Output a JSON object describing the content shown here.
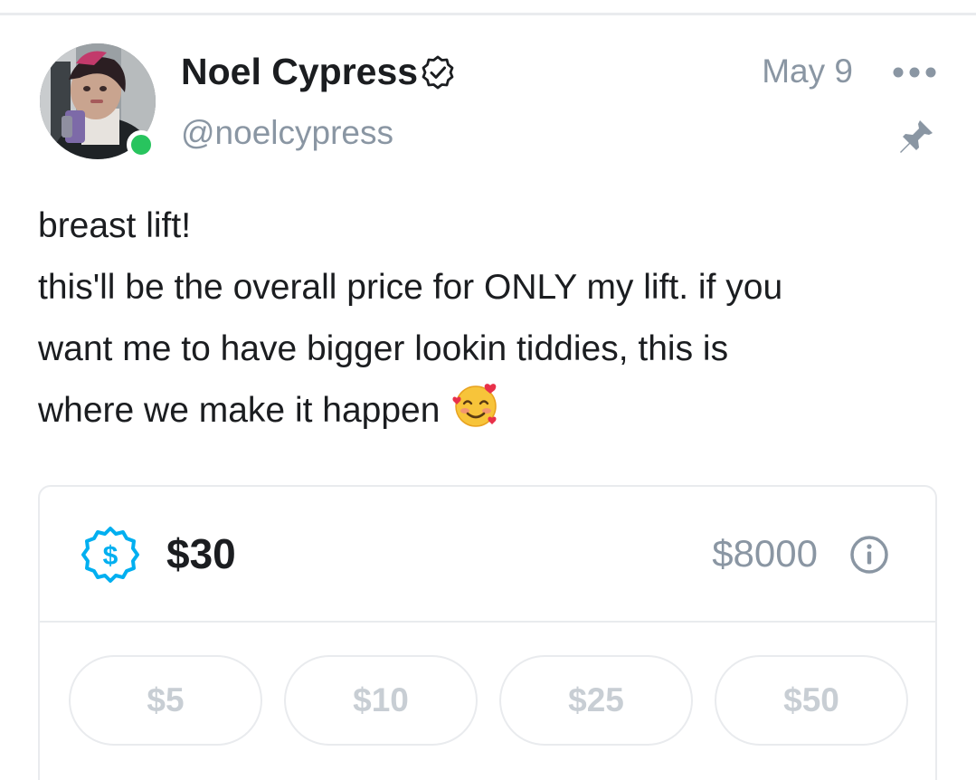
{
  "post": {
    "author": {
      "display_name": "Noel Cypress",
      "username": "@noelcypress",
      "verified_icon": "verified-badge-icon",
      "online": true
    },
    "date": "May 9",
    "pinned": true,
    "text_lines": [
      "breast lift!",
      "this'll be the overall price for ONLY my lift. if you",
      "want me to have bigger lookin tiddies, this is",
      "where we make it happen"
    ],
    "emoji": "smiling-face-with-hearts"
  },
  "tip_goal": {
    "icon": "dollar-badge-icon",
    "current_amount": "$30",
    "goal_amount": "$8000",
    "info_icon": "info-icon",
    "presets": [
      "$5",
      "$10",
      "$25",
      "$50"
    ]
  },
  "colors": {
    "text_primary": "#1b1d20",
    "text_secondary": "#8a96a3",
    "accent": "#00aff0",
    "online": "#28c45e",
    "border": "#e9ebee",
    "preset_text": "#c8ced4"
  }
}
